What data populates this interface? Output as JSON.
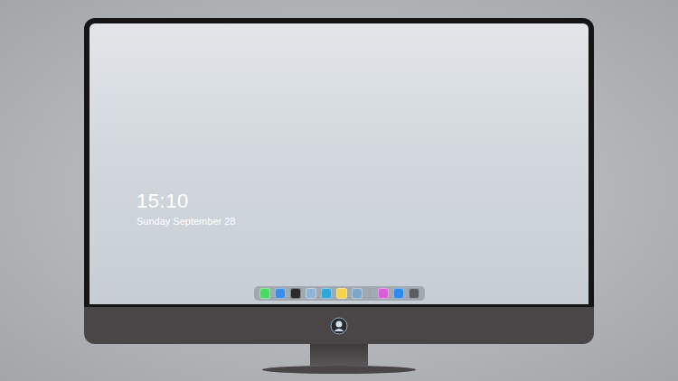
{
  "lock_screen": {
    "time": "15:10",
    "date": "Sunday September 28"
  },
  "dock": [
    {
      "kind": "app",
      "color": "#4cd964"
    },
    {
      "kind": "app",
      "color": "#3b8fe6"
    },
    {
      "kind": "app",
      "color": "#2b2b2b"
    },
    {
      "kind": "app",
      "color": "#8fb6d8"
    },
    {
      "kind": "app",
      "color": "#2fa7d8"
    },
    {
      "kind": "app",
      "color": "#f5d34a"
    },
    {
      "kind": "app",
      "color": "#7aa6c9"
    },
    {
      "kind": "separator",
      "color": "#9aa0a6"
    },
    {
      "kind": "app",
      "color": "#d85fd6"
    },
    {
      "kind": "app",
      "color": "#2d8bf0"
    },
    {
      "kind": "app",
      "color": "#5a5d61"
    }
  ]
}
